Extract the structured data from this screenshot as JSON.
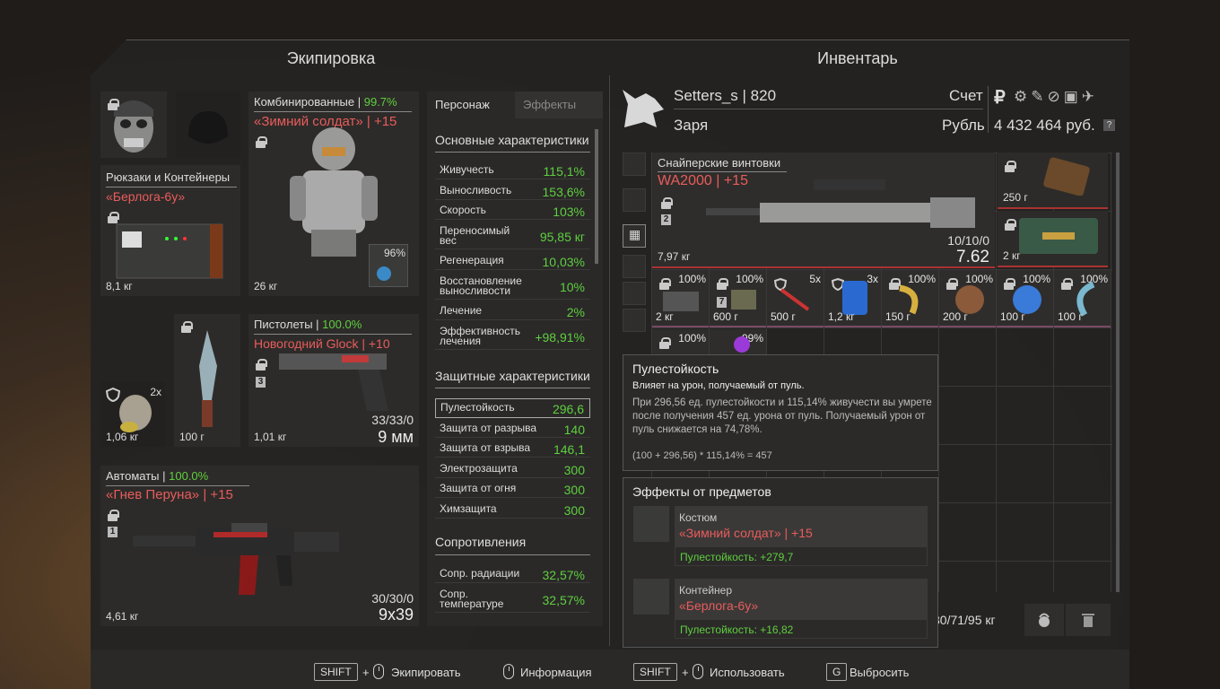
{
  "equipment": {
    "title": "Экипировка",
    "backpack": {
      "category": "Рюкзаки и Контейнеры",
      "name": "«Берлога-6у»",
      "weight": "8,1 кг"
    },
    "suit": {
      "category": "Комбинированные",
      "durability": "99.7%",
      "name": "«Зимний солдат» | +15",
      "weight": "26 кг",
      "sub_percent": "96%"
    },
    "grenade": {
      "count": "2x",
      "weight": "1,06 кг"
    },
    "knife": {
      "weight": "100 г"
    },
    "pistol": {
      "category": "Пистолеты",
      "durability": "100.0%",
      "name": "Новогодний Glock | +10",
      "badge": "3",
      "ammo": "33/33/0",
      "caliber": "9 мм",
      "weight": "1,01 кг"
    },
    "rifle": {
      "category": "Автоматы",
      "durability": "100.0%",
      "name": "«Гнев Перуна» | +15",
      "badge": "1",
      "ammo": "30/30/0",
      "caliber": "9x39",
      "weight": "4,61 кг"
    }
  },
  "stats": {
    "tabs": [
      "Персонаж",
      "Эффекты"
    ],
    "main_title": "Основные характеристики",
    "main": [
      {
        "k": "Живучесть",
        "v": "115,1%"
      },
      {
        "k": "Выносливость",
        "v": "153,6%"
      },
      {
        "k": "Скорость",
        "v": "103%"
      },
      {
        "k": "Переносимый вес",
        "v": "95,85 кг"
      },
      {
        "k": "Регенерация",
        "v": "10,03%"
      },
      {
        "k": "Восстановление выносливости",
        "v": "10%"
      },
      {
        "k": "Лечение",
        "v": "2%"
      },
      {
        "k": "Эффективность лечения",
        "v": "+98,91%"
      }
    ],
    "prot_title": "Защитные характеристики",
    "prot": [
      {
        "k": "Пулестойкость",
        "v": "296,6"
      },
      {
        "k": "Защита от разрыва",
        "v": "140"
      },
      {
        "k": "Защита от взрыва",
        "v": "146,1"
      },
      {
        "k": "Электрозащита",
        "v": "300"
      },
      {
        "k": "Защита от огня",
        "v": "300"
      },
      {
        "k": "Химзащита",
        "v": "300"
      }
    ],
    "res_title": "Сопротивления",
    "res": [
      {
        "k": "Сопр. радиации",
        "v": "32,57%"
      },
      {
        "k": "Сопр. температуре",
        "v": "32,57%"
      }
    ]
  },
  "inventory": {
    "title": "Инвентарь",
    "player": "Setters_s | 820",
    "faction": "Заря",
    "account_label": "Счет",
    "currency_label": "Рубль",
    "money": "4 432 464 руб.",
    "help": "?",
    "weapon": {
      "category": "Снайперские винтовки",
      "name": "WA2000 | +15",
      "badge": "2",
      "ammo": "10/10/0",
      "caliber": "7.62",
      "weight": "7,97 кг"
    },
    "side": [
      {
        "w": "250 г"
      },
      {
        "w": "2 кг"
      }
    ],
    "cells_row1": [
      {
        "p": "100%",
        "w": "2 кг"
      },
      {
        "p": "100%",
        "w": "600 г",
        "badge": "7"
      },
      {
        "p": "5x",
        "w": "500 г"
      },
      {
        "p": "3x",
        "w": "1,2 кг"
      },
      {
        "p": "100%",
        "w": "150 г"
      },
      {
        "p": "100%",
        "w": "200 г"
      },
      {
        "p": "100%",
        "w": "100 г"
      },
      {
        "p": "100%",
        "w": "100 г"
      }
    ],
    "cells_row2": [
      {
        "p": "100%"
      },
      {
        "p": "99%"
      }
    ],
    "weight": "30/71/95 кг"
  },
  "tooltip": {
    "title": "Пулестойкость",
    "subtitle": "Влияет на урон, получаемый от пуль.",
    "body": "При 296,56 ед. пулестойкости и 115,14% живучести вы умрете после получения 457 ед. урона от пуль. Получаемый урон от пуль снижается на 74,78%.",
    "formula": "(100 + 296,56) * 115,14% = 457"
  },
  "effects": {
    "title": "Эффекты от предметов",
    "items": [
      {
        "type": "Костюм",
        "name": "«Зимний солдат» | +15",
        "bonus": "Пулестойкость: +279,7"
      },
      {
        "type": "Контейнер",
        "name": "«Берлога-6у»",
        "bonus": "Пулестойкость: +16,82"
      }
    ]
  },
  "footer": {
    "shift": "SHIFT",
    "plus": "+",
    "equip": "Экипировать",
    "info": "Информация",
    "use": "Использовать",
    "g": "G",
    "drop": "Выбросить"
  },
  "colors": {
    "accent_green": "#5fcf3f",
    "accent_red": "#e85c5c",
    "rarity_purple": "#7a4a66"
  }
}
